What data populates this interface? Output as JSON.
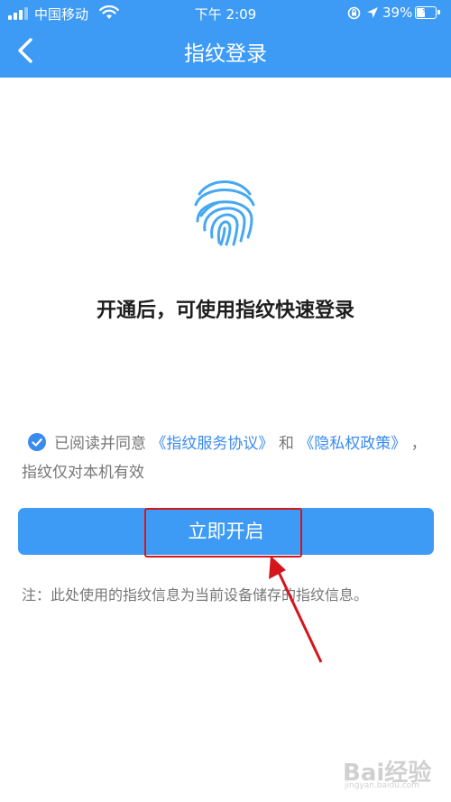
{
  "status_bar": {
    "carrier": "中国移动",
    "time": "下午 2:09",
    "battery": "39%",
    "battery_level": 0.39,
    "icons": [
      "signal-icon",
      "wifi-icon",
      "orientation-lock-icon",
      "location-arrow-icon",
      "battery-charging-icon"
    ]
  },
  "nav": {
    "title": "指纹登录",
    "back_icon": "chevron-left-icon"
  },
  "main": {
    "fingerprint_icon": "fingerprint-icon",
    "headline": "开通后，可使用指纹快速登录",
    "agreement": {
      "checked": true,
      "prefix": "已阅读并同意",
      "link1": "《指纹服务协议》",
      "conj": "和",
      "link2": "《隐私权政策》",
      "suffix": "，指纹仅对本机有效"
    },
    "enable_button": "立即开启",
    "note": "注：此处使用的指纹信息为当前设备储存的指纹信息。"
  },
  "watermark": {
    "text": "Bai经验",
    "url": "jingyan.baidu.com"
  },
  "colors": {
    "primary": "#3d9bf5",
    "link": "#3a8bf0",
    "annotation": "#d4161b"
  }
}
